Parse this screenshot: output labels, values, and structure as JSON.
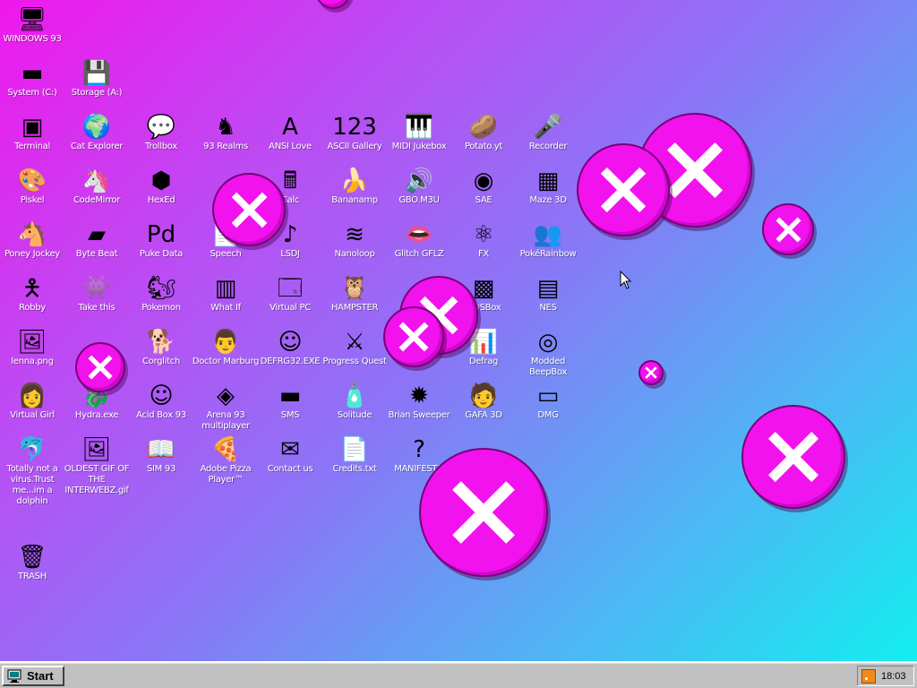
{
  "desktop": {
    "icons": [
      {
        "label": "WINDOWS 93",
        "icon": "computer-icon",
        "glyph": "🖥"
      },
      {
        "label": "System (C:)",
        "icon": "drive-icon",
        "glyph": "▬"
      },
      {
        "label": "Storage (A:)",
        "icon": "floppy-drive-icon",
        "glyph": "💾"
      },
      {
        "label": "Terminal",
        "icon": "terminal-icon",
        "glyph": "▣"
      },
      {
        "label": "Cat Explorer",
        "icon": "cat-globe-icon",
        "glyph": "🌍"
      },
      {
        "label": "Trollbox",
        "icon": "chat-bubble-icon",
        "glyph": "💬"
      },
      {
        "label": "93 Realms",
        "icon": "knight-icon",
        "glyph": "♞"
      },
      {
        "label": "ANSI Love",
        "icon": "ansi-icon",
        "glyph": "A"
      },
      {
        "label": "ASCII Gallery",
        "icon": "ascii-icon",
        "glyph": "123"
      },
      {
        "label": "MIDI Jukebox",
        "icon": "piano-icon",
        "glyph": "🎹"
      },
      {
        "label": "Potato.yt",
        "icon": "potato-icon",
        "glyph": "🥔"
      },
      {
        "label": "Recorder",
        "icon": "microphone-icon",
        "glyph": "🎤"
      },
      {
        "label": "Piskel",
        "icon": "palette-icon",
        "glyph": "🎨"
      },
      {
        "label": "CodeMirror",
        "icon": "unicorn-icon",
        "glyph": "🦄"
      },
      {
        "label": "HexEd",
        "icon": "cube-icon",
        "glyph": "⬢"
      },
      {
        "label": "Calc",
        "icon": "calculator-icon",
        "glyph": "🖩"
      },
      {
        "label": "Bananamp",
        "icon": "banana-icon",
        "glyph": "🍌"
      },
      {
        "label": "GBO.M3U",
        "icon": "audio-file-icon",
        "glyph": "🔊"
      },
      {
        "label": "SAE",
        "icon": "ball-icon",
        "glyph": "◉"
      },
      {
        "label": "Maze 3D",
        "icon": "maze-icon",
        "glyph": "▦"
      },
      {
        "label": "Poney Jockey",
        "icon": "pony-icon",
        "glyph": "🐴"
      },
      {
        "label": "Byte Beat",
        "icon": "bytebeat-icon",
        "glyph": "▰"
      },
      {
        "label": "Puke Data",
        "icon": "pd-icon",
        "glyph": "Pd"
      },
      {
        "label": "Speech",
        "icon": "speech-icon",
        "glyph": "📄"
      },
      {
        "label": "LSDJ",
        "icon": "lsdj-icon",
        "glyph": "♪"
      },
      {
        "label": "Nanoloop",
        "icon": "nanoloop-icon",
        "glyph": "≋"
      },
      {
        "label": "Glitch GFLZ",
        "icon": "lips-icon",
        "glyph": "👄"
      },
      {
        "label": "FX",
        "icon": "atom-icon",
        "glyph": "⚛"
      },
      {
        "label": "PokéRainbow",
        "icon": "pokerainbow-icon",
        "glyph": "👥"
      },
      {
        "label": "Robby",
        "icon": "stickman-icon",
        "glyph": "🯅"
      },
      {
        "label": "Take this",
        "icon": "character-icon",
        "glyph": "👾"
      },
      {
        "label": "Pokemon",
        "icon": "pokemon-icon",
        "glyph": "🐿"
      },
      {
        "label": "What If",
        "icon": "whatif-icon",
        "glyph": "▥"
      },
      {
        "label": "Virtual PC",
        "icon": "virtual-pc-icon",
        "glyph": "🗔"
      },
      {
        "label": "HAMPSTER",
        "icon": "owl-icon",
        "glyph": "🦉"
      },
      {
        "label": "DOSBox",
        "icon": "dosbox-icon",
        "glyph": "▩"
      },
      {
        "label": "NES",
        "icon": "nes-icon",
        "glyph": "▤"
      },
      {
        "label": "lenna.png",
        "icon": "image-file-icon",
        "glyph": "🖼"
      },
      {
        "label": "Corglitch",
        "icon": "corgi-icon",
        "glyph": "🐕"
      },
      {
        "label": "Doctor Marburg",
        "icon": "doctor-icon",
        "glyph": "👨"
      },
      {
        "label": "DEFRG32.EXE",
        "icon": "defrag-face-icon",
        "glyph": "☺"
      },
      {
        "label": "Progress Quest",
        "icon": "swords-icon",
        "glyph": "⚔"
      },
      {
        "label": "Defrag",
        "icon": "defrag-icon",
        "glyph": "📊"
      },
      {
        "label": "Modded BeepBox",
        "icon": "beepbox-icon",
        "glyph": "◎"
      },
      {
        "label": "Virtual Girl",
        "icon": "virtual-girl-icon",
        "glyph": "👩"
      },
      {
        "label": "Hydra.exe",
        "icon": "hydra-icon",
        "glyph": "🐉"
      },
      {
        "label": "Acid Box 93",
        "icon": "smiley-icon",
        "glyph": "☺"
      },
      {
        "label": "Arena 93 multiplayer",
        "icon": "cube-arena-icon",
        "glyph": "◈"
      },
      {
        "label": "SMS",
        "icon": "sms-icon",
        "glyph": "▬"
      },
      {
        "label": "Solitude",
        "icon": "solitude-icon",
        "glyph": "🧴"
      },
      {
        "label": "Brian Sweeper",
        "icon": "mine-icon",
        "glyph": "✹"
      },
      {
        "label": "GAFA 3D",
        "icon": "doomguy-icon",
        "glyph": "🧑"
      },
      {
        "label": "DMG",
        "icon": "dmg-icon",
        "glyph": "▭"
      },
      {
        "label": "Totally not a virus.Trust me...im a dolphin",
        "icon": "dolphin-icon",
        "glyph": "🐬"
      },
      {
        "label": "OLDEST GIF OF THE INTERWEBZ.gif",
        "icon": "gif-file-icon",
        "glyph": "🖼"
      },
      {
        "label": "SIM 93",
        "icon": "book-icon",
        "glyph": "📖"
      },
      {
        "label": "Adobe Pizza Player™",
        "icon": "pizza-icon",
        "glyph": "🍕"
      },
      {
        "label": "Contact us",
        "icon": "contact-icon",
        "glyph": "✉"
      },
      {
        "label": "Credits.txt",
        "icon": "text-file-icon",
        "glyph": "📄"
      },
      {
        "label": "MANIFESTO",
        "icon": "question-icon",
        "glyph": "?"
      },
      {
        "label": "TRASH",
        "icon": "trash-icon",
        "glyph": "🗑"
      }
    ]
  },
  "colors": {
    "bubble": "#f112ee",
    "bubble_border": "#7a0078",
    "gradient_start": "#f018ec",
    "gradient_end": "#0ef2f0"
  },
  "taskbar": {
    "start_label": "Start",
    "tray_icon": "rss-icon",
    "clock": "18:03"
  }
}
